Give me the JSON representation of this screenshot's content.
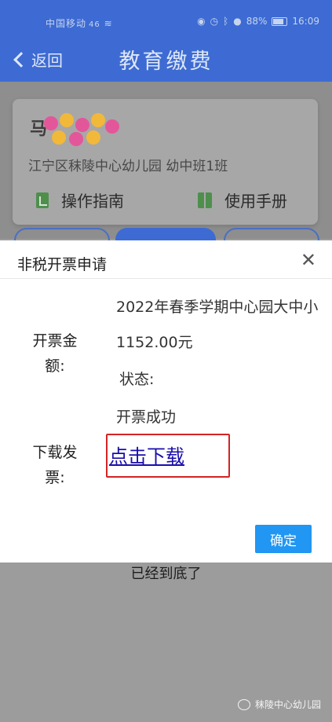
{
  "status_bar": {
    "carrier": "中国移动",
    "signal": "46",
    "battery": "88%",
    "time": "16:09"
  },
  "nav": {
    "back_label": "返回",
    "title": "教育缴费"
  },
  "card": {
    "student_name_initial": "马",
    "school_info": "江宁区秣陵中心幼儿园   幼中班1班",
    "menu": [
      {
        "label": "操作指南",
        "icon": "guide-icon"
      },
      {
        "label": "使用手册",
        "icon": "book-icon"
      }
    ]
  },
  "dialog": {
    "title": "非税开票申请",
    "item_name": "2022年春季学期中心园大中小",
    "amount_label": "开票金额:",
    "amount_value": "1152.00元",
    "status_label": "状态:",
    "status_value": "开票成功",
    "download_label": "下载发票:",
    "download_link": "点击下载",
    "confirm_button": "确定"
  },
  "list_end_text": "已经到底了",
  "watermark": "秣陵中心幼儿园",
  "colors": {
    "primary": "#3d6bd3",
    "button": "#2196f3",
    "highlight": "#d32424",
    "link": "#1a0dab"
  }
}
